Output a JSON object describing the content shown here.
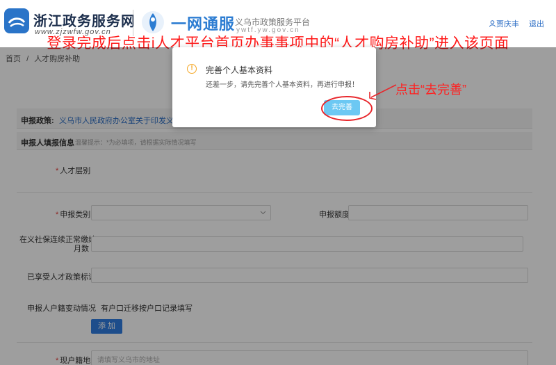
{
  "header": {
    "portal_title": "浙江政务服务网",
    "portal_url": "www.zjzwfw.gov.cn",
    "service_title": "一网通服",
    "service_subtitle": "义乌市政策服务平台",
    "service_url": "ywtf.yw.gov.cn",
    "user_name": "贾庆丰",
    "logout_label": "退出"
  },
  "annotation": {
    "banner": "登录完成后点击i人才平台首页办事事项中的“人才购房补助”进入该页面",
    "callout": "点击“去完善”",
    "accent_color": "#ff1a1a"
  },
  "breadcrumb": {
    "home": "首页",
    "separator": "/",
    "current": "人才购房补助"
  },
  "policy": {
    "label": "申报政策:",
    "value": "义乌市人民政府办公室关于印发义乌市"
  },
  "applicant": {
    "label": "申报人填报信息",
    "hint": "温馨提示：*为必填项，请根据实际情况填写"
  },
  "form": {
    "talent_category_label": "人才层别",
    "apply_type_label": "申报类别",
    "apply_amount_label": "申报额度",
    "social_security_label_line1": "在义社保连续正常缴纳",
    "social_security_label_line2": "月数",
    "enjoyed_policy_label": "已享受人才政策标识",
    "household_change_label": "申报人户籍变动情况",
    "household_change_hint": "有户口迁移按户口记录填写",
    "add_button": "添 加",
    "current_address_label": "现户籍地",
    "current_address_placeholder": "请填写义乌市的地址",
    "required_mark": "*"
  },
  "modal": {
    "icon": "warning-icon",
    "title": "完善个人基本资料",
    "text": "还差一步，请先完善个人基本资料，再进行申报！",
    "button": "去完善",
    "button_color": "#6cc8f3"
  }
}
